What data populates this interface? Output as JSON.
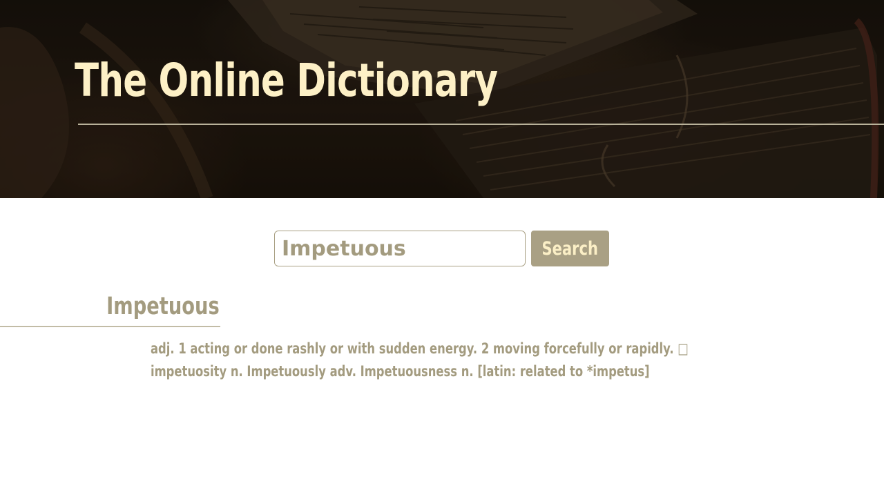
{
  "header": {
    "title": "The Online Dictionary"
  },
  "search": {
    "value": "Impetuous",
    "placeholder": "",
    "button_label": "Search"
  },
  "entry": {
    "word": "Impetuous",
    "definition": "adj. 1 acting or done rashly or with sudden energy. 2 moving forcefully or rapidly. □ impetuosity n. Impetuously adv. Impetuousness n. [latin: related to *impetus]"
  },
  "colors": {
    "title": "#fdf0c6",
    "accent": "#a9a084",
    "text": "#a39b7f"
  },
  "icons": {
    "hero_background": "old-book-image"
  }
}
